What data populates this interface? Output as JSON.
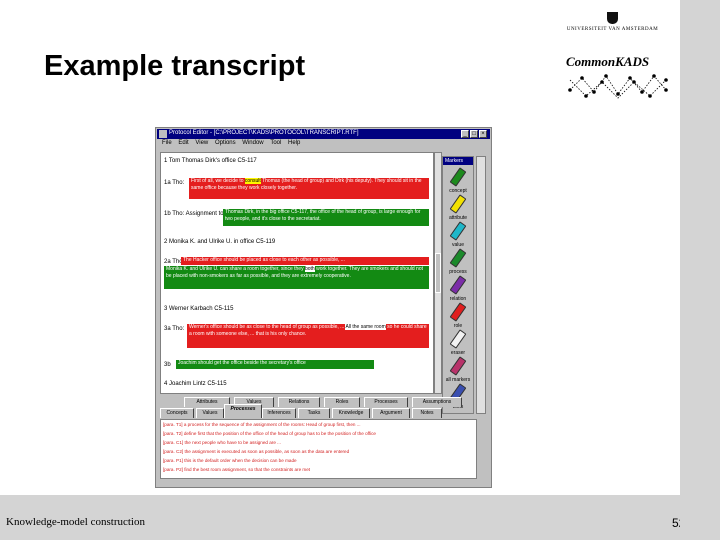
{
  "slide": {
    "title": "Example transcript",
    "footer": "Knowledge-model construction",
    "page_number": "52",
    "logo_university": "UNIVERSITEIT VAN AMSTERDAM",
    "logo_commonkads": "CommonKADS"
  },
  "app": {
    "window_title": "Protocol Editor - [C:\\PROJECT\\KADS\\PROTOCOL\\TRANSCRIPT.RTF]",
    "menu": [
      "File",
      "Edit",
      "View",
      "Options",
      "Window",
      "Tool",
      "Help"
    ],
    "window_buttons": [
      "_",
      "□",
      "×"
    ],
    "document": {
      "lines": [
        {
          "id": "l1",
          "text": "1 Tom Thomas Dirk's office C5-117"
        },
        {
          "id": "l2",
          "speaker": "1a Tho:"
        },
        {
          "id": "l3",
          "speaker": "1b Tho: Assignment to"
        },
        {
          "id": "l4",
          "text": "2 Monika K. and Ulrike U. in office C5-119"
        },
        {
          "id": "l5",
          "speaker": "2a Tho:"
        },
        {
          "id": "l6",
          "text": "3 Werner Karbach C5-115"
        },
        {
          "id": "l7",
          "speaker": "3a Tho:"
        },
        {
          "id": "l8",
          "speaker": "3b"
        },
        {
          "id": "l9",
          "text": "4 Joachim Lintz C5-115"
        }
      ],
      "segments": [
        {
          "id": "s1",
          "text": "First of all, we decide to",
          "highlight": "consult",
          "text2": "Thomas (the head of group) and Dirk (his",
          "text3": "deputy). They should sit in the same office because they work closely together."
        },
        {
          "id": "s2",
          "text": "Thomas Dirk, in the big office C5-117, the office of the head of group,",
          "text2": "is large enough for two people, and it's close to the secretariat."
        },
        {
          "id": "s3a",
          "text": "The Hacker office should be placed as close to each other as possible, ..."
        },
        {
          "id": "s3b",
          "text": "Monika K. and Ulrike U. can share a room together, since they",
          "highlight": "both",
          "text2": "work together. They are smokers and should not be placed with non-smokers as far as possible,",
          "text3": "and they are extremely cooperative."
        },
        {
          "id": "s4",
          "text": "Werner's office should be as close to the head of group as possible, ...",
          "highlight": "All the same room",
          "text2": "so he could share a room with someone else, ...",
          "text3": "that is his only chance."
        },
        {
          "id": "s5",
          "text": "Joachim should get the office beside the secretary's office"
        }
      ]
    },
    "palette": {
      "title": "Markers",
      "items": [
        {
          "label": "concept",
          "color": "#1d8a1d"
        },
        {
          "label": "attribute",
          "color": "#f2e100"
        },
        {
          "label": "value",
          "color": "#1fb7c9"
        },
        {
          "label": "process",
          "color": "#1b8a2b"
        },
        {
          "label": "relation",
          "color": "#7b2da8"
        },
        {
          "label": "role",
          "color": "#e01f1f"
        },
        {
          "label": "eraser",
          "color": "#f2f2f2"
        },
        {
          "label": "all markers",
          "color": "#b8336a"
        },
        {
          "label": "tools",
          "color": "#3a4fb0"
        }
      ]
    },
    "tabs_back": [
      "Attributes",
      "Values",
      "Relations",
      "Roles",
      "Processes",
      "Assumptions"
    ],
    "tabs_front": [
      "Concepts",
      "Values",
      "Processes",
      "Inferences",
      "Tasks",
      "Knowledge",
      "Argument",
      "Notes"
    ],
    "active_tab": "Processes",
    "annotations": [
      "[para. T1] a process for the sequence of the assignment of the rooms: Head of group first, then ...",
      "[para. T2] define first that the position of the office of the head of group has to be the position of the office",
      "[para. C1] the next people who have to be assigned are ...",
      "[para. C2] the assignment is executed as soon as possible, as soon as the data are entered",
      "[para. P1] this is the default order when the decision can be made",
      "[para. P2] find the best room assignment, so that the constraints are met"
    ]
  }
}
